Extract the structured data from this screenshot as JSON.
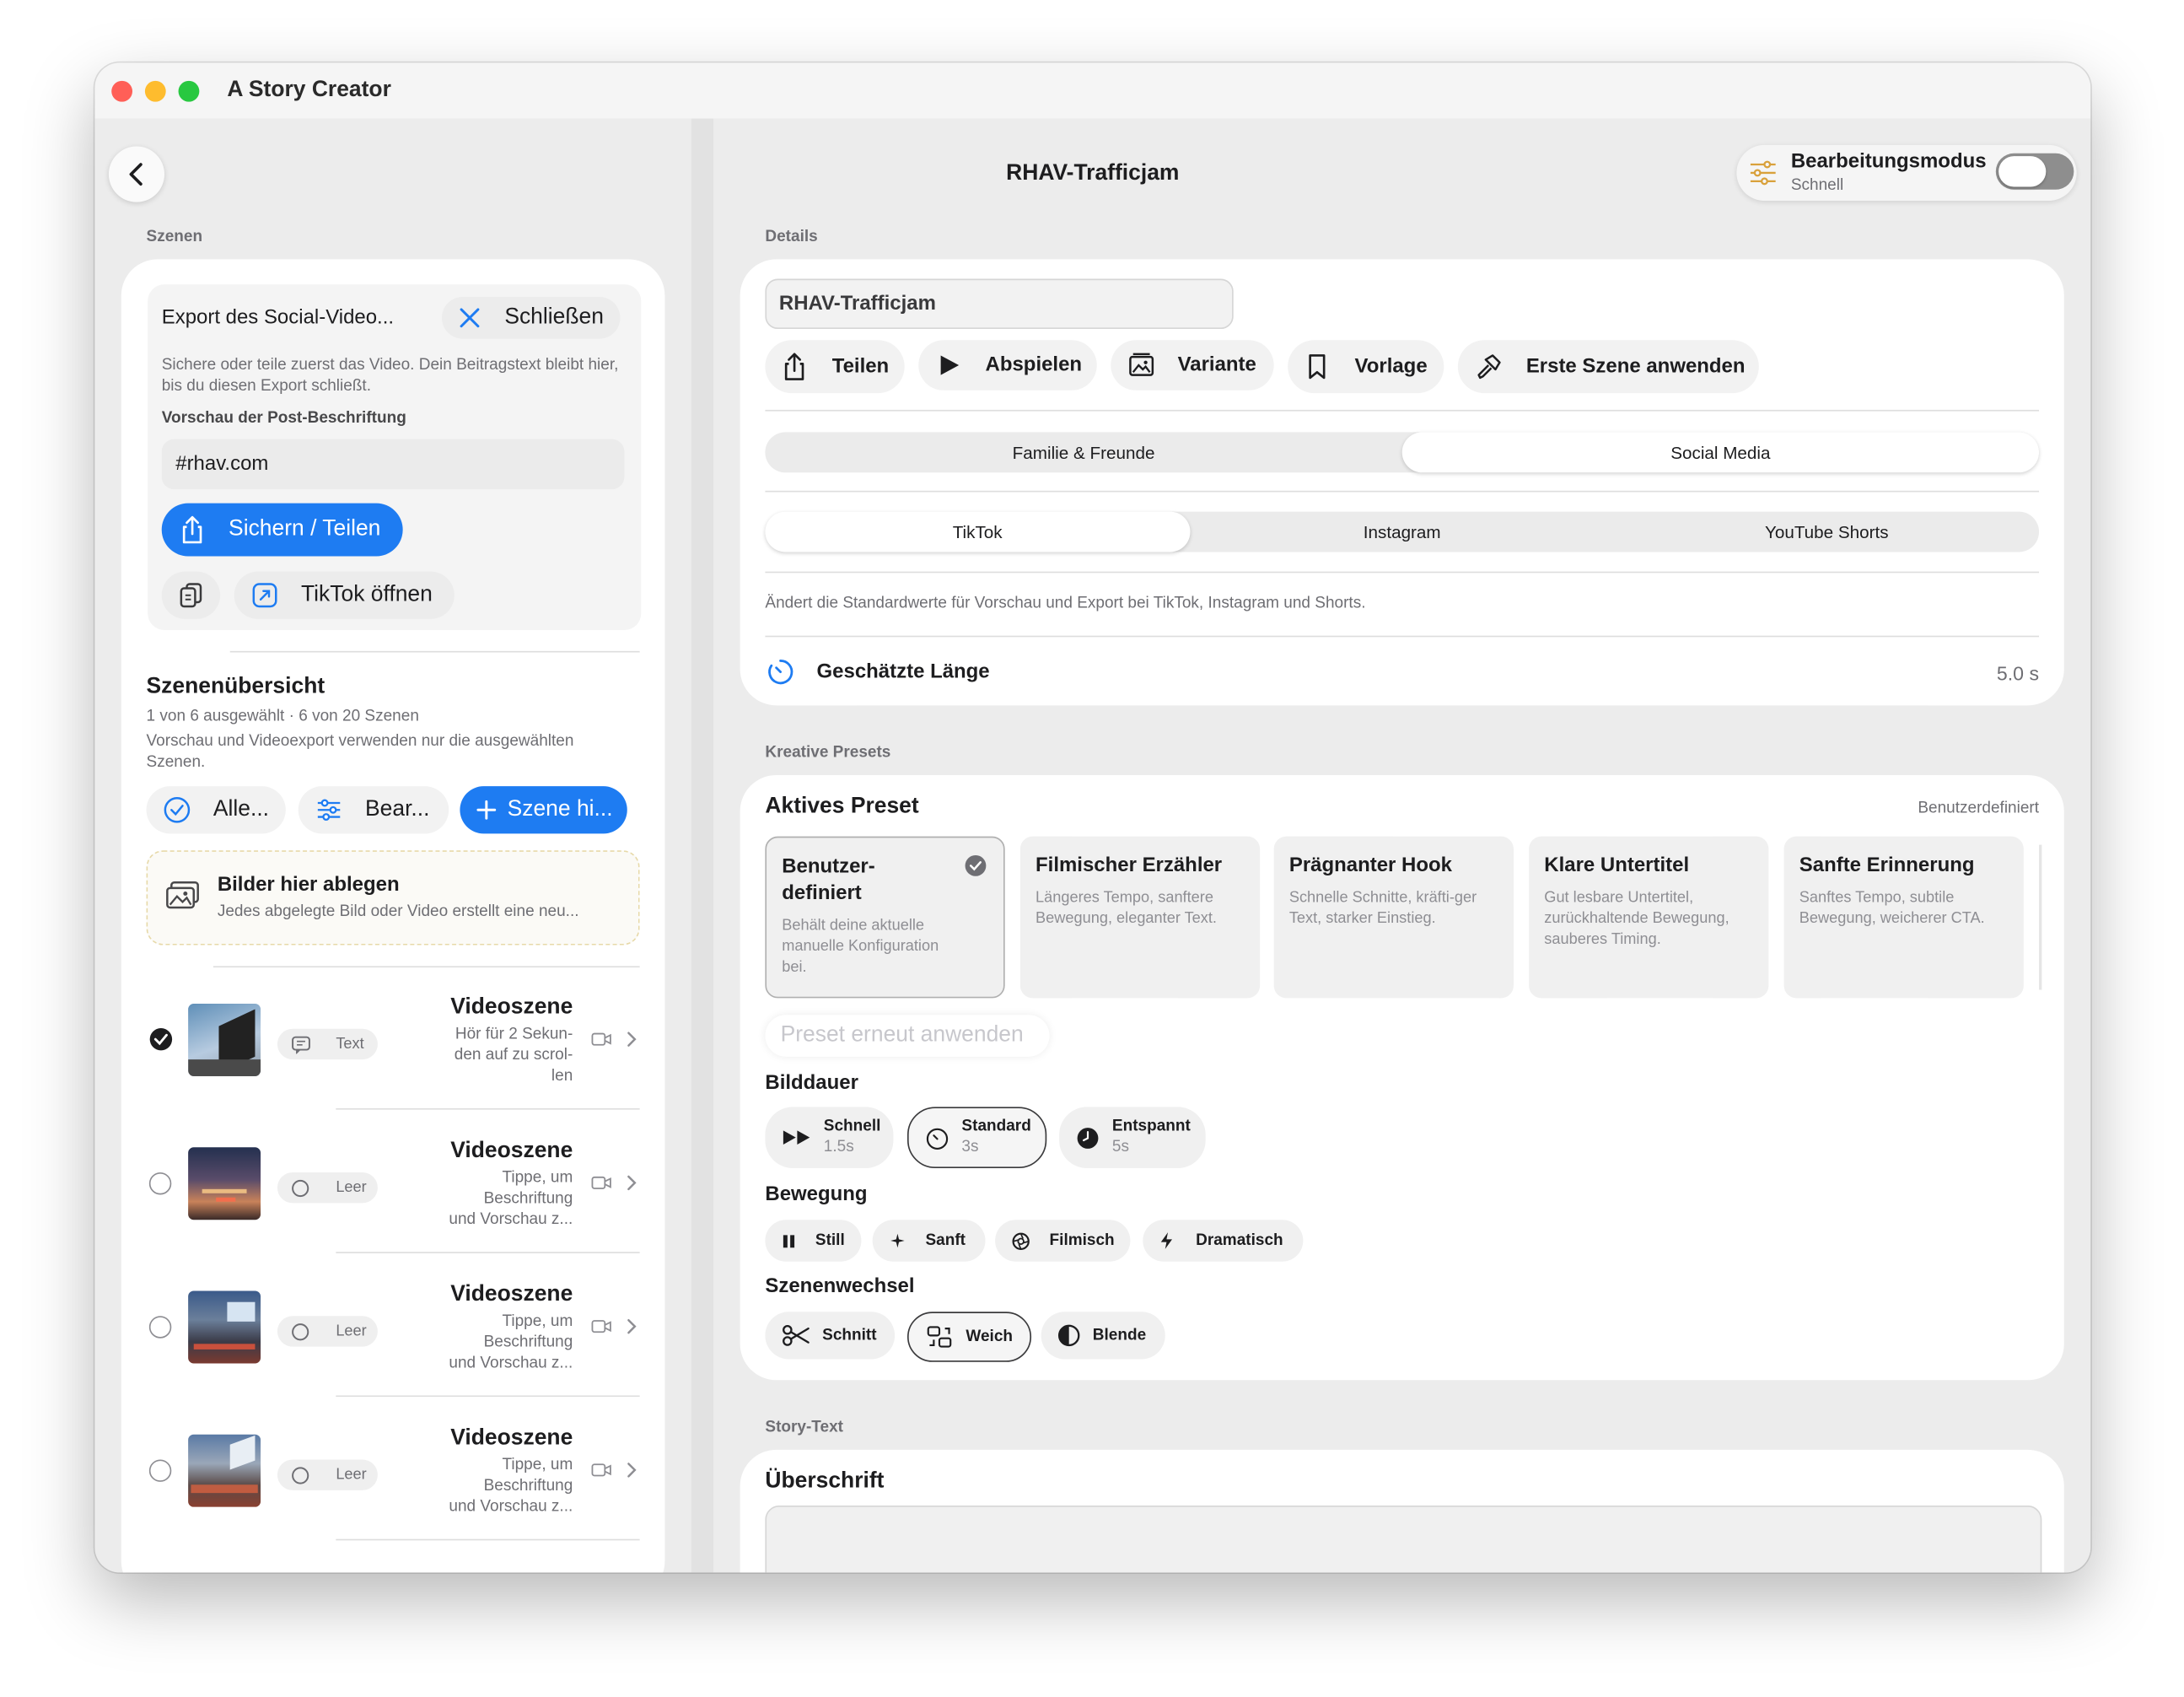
{
  "window": {
    "title": "A Story Creator"
  },
  "left": {
    "section_label": "Szenen",
    "export": {
      "title": "Export des Social-Video...",
      "close_label": "Schließen",
      "description": "Sichere oder teile zuerst das Video. Dein Beitragstext bleibt hier, bis du diesen Export schließt.",
      "caption_label": "Vorschau der Post-Beschriftung",
      "caption_value": "#rhav.com",
      "save_share_label": "Sichern / Teilen",
      "open_tiktok_label": "TikTok öffnen"
    },
    "overview": {
      "title": "Szenenübersicht",
      "count": "1 von 6 ausgewählt · 6 von 20 Szenen",
      "note": "Vorschau und Videoexport verwenden nur die ausgewählten Szenen.",
      "all_label": "Alle...",
      "edit_label": "Bear...",
      "add_label": "Szene hi..."
    },
    "drop": {
      "title": "Bilder hier ablegen",
      "subtitle": "Jedes abgelegte Bild oder Video erstellt eine neu..."
    },
    "scenes": [
      {
        "title": "Videoszene",
        "tag": "Text",
        "line1": "Hör für 2 Sekun-",
        "line2": "den auf zu scrol-",
        "line3": "len",
        "selected": true
      },
      {
        "title": "Videoszene",
        "tag": "Leer",
        "line1": "Tippe, um",
        "line2": "Beschriftung",
        "line3": "und Vorschau z...",
        "selected": false
      },
      {
        "title": "Videoszene",
        "tag": "Leer",
        "line1": "Tippe, um",
        "line2": "Beschriftung",
        "line3": "und Vorschau z...",
        "selected": false
      },
      {
        "title": "Videoszene",
        "tag": "Leer",
        "line1": "Tippe, um",
        "line2": "Beschriftung",
        "line3": "und Vorschau z...",
        "selected": false
      }
    ]
  },
  "right": {
    "title": "RHAV-Trafficjam",
    "mode": {
      "label": "Bearbeitungsmodus",
      "value": "Schnell",
      "enabled": false
    },
    "details_label": "Details",
    "name_value": "RHAV-Trafficjam",
    "actions": {
      "share": "Teilen",
      "play": "Abspielen",
      "variant": "Variante",
      "template": "Vorlage",
      "apply_first": "Erste Szene anwenden"
    },
    "audience": {
      "options": [
        "Familie & Freunde",
        "Social Media"
      ],
      "selected": "Social Media"
    },
    "platform": {
      "options": [
        "TikTok",
        "Instagram",
        "YouTube Shorts"
      ],
      "selected": "TikTok"
    },
    "platform_hint": "Ändert die Standardwerte für Vorschau und Export bei TikTok, Instagram und Shorts.",
    "length": {
      "label": "Geschätzte Länge",
      "value": "5.0 s"
    },
    "presets_label": "Kreative Presets",
    "active_preset": {
      "title": "Aktives Preset",
      "value": "Benutzerdefiniert"
    },
    "presets": [
      {
        "title1": "Benutzer-",
        "title2": "definiert",
        "desc": "Behält deine aktuelle manuelle Konfiguration bei.",
        "selected": true
      },
      {
        "title1": "Filmischer Erzähler",
        "title2": "",
        "desc": "Längeres Tempo, sanftere Bewegung, eleganter Text.",
        "selected": false
      },
      {
        "title1": "Prägnanter Hook",
        "title2": "",
        "desc": "Schnelle Schnitte, kräfti-ger Text, starker Einstieg.",
        "selected": false
      },
      {
        "title1": "Klare Untertitel",
        "title2": "",
        "desc": "Gut lesbare Untertitel, zurückhaltende Bewegung, sauberes Timing.",
        "selected": false
      },
      {
        "title1": "Sanfte Erinnerung",
        "title2": "",
        "desc": "Sanftes Tempo, subtile Bewegung, weicherer CTA.",
        "selected": false
      }
    ],
    "reapply_label": "Preset erneut anwenden",
    "duration": {
      "label": "Bilddauer",
      "options": [
        {
          "name": "Schnell",
          "value": "1.5s"
        },
        {
          "name": "Standard",
          "value": "3s"
        },
        {
          "name": "Entspannt",
          "value": "5s"
        }
      ],
      "selected": "Standard"
    },
    "motion": {
      "label": "Bewegung",
      "options": [
        "Still",
        "Sanft",
        "Filmisch",
        "Dramatisch"
      ]
    },
    "transition": {
      "label": "Szenenwechsel",
      "options": [
        "Schnitt",
        "Weich",
        "Blende"
      ],
      "selected": "Weich"
    },
    "story_label": "Story-Text",
    "headline_label": "Überschrift"
  },
  "colors": {
    "accent": "#1e7cf2",
    "background": "#ececec",
    "card": "#ffffff"
  }
}
